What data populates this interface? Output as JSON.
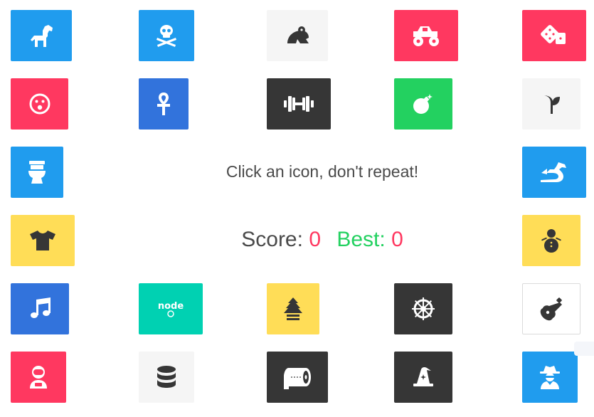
{
  "game": {
    "instruction": "Click an icon, don't repeat!",
    "score_label": "Score:",
    "score": "0",
    "best_label": "Best:",
    "best": "0"
  },
  "colors": {
    "blue": "#209cee",
    "royal": "#3273dc",
    "red": "#ff3860",
    "dark": "#363636",
    "light": "#f5f5f5",
    "green": "#23d160",
    "yellow": "#ffdd57",
    "teal": "#00d1b2",
    "white": "#ffffff"
  },
  "tiles": [
    {
      "icon": "horse-icon",
      "color": "blue"
    },
    {
      "icon": "skull-crossbones-icon",
      "color": "blue"
    },
    {
      "icon": "frog-icon",
      "color": "light"
    },
    {
      "icon": "monster-truck-icon",
      "color": "red"
    },
    {
      "icon": "dice-icon",
      "color": "red"
    },
    {
      "icon": "surprised-face-icon",
      "color": "red"
    },
    {
      "icon": "ankh-icon",
      "color": "royal"
    },
    {
      "icon": "dumbbell-icon",
      "color": "dark"
    },
    {
      "icon": "bomb-icon",
      "color": "green"
    },
    {
      "icon": "seedling-icon",
      "color": "light"
    },
    {
      "icon": "toilet-icon",
      "color": "blue"
    },
    {
      "icon": "dragon-icon",
      "color": "blue"
    },
    {
      "icon": "tshirt-icon",
      "color": "yellow"
    },
    {
      "icon": "snowman-icon",
      "color": "yellow"
    },
    {
      "icon": "music-icon",
      "color": "royal"
    },
    {
      "icon": "node-js-icon",
      "color": "teal"
    },
    {
      "icon": "tree-icon",
      "color": "yellow"
    },
    {
      "icon": "dharmachakra-icon",
      "color": "dark"
    },
    {
      "icon": "guitar-icon",
      "color": "white"
    },
    {
      "icon": "user-astronaut-icon",
      "color": "red"
    },
    {
      "icon": "database-icon",
      "color": "light"
    },
    {
      "icon": "toilet-paper-icon",
      "color": "dark"
    },
    {
      "icon": "hat-wizard-icon",
      "color": "dark"
    },
    {
      "icon": "user-secret-icon",
      "color": "blue"
    }
  ]
}
